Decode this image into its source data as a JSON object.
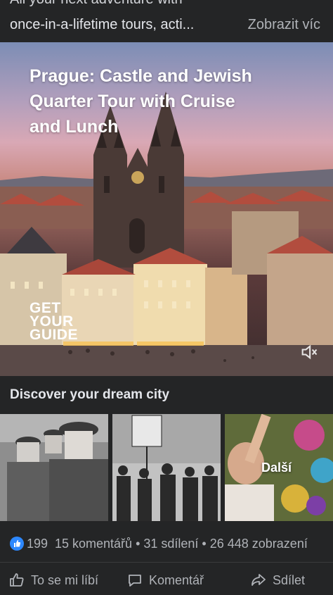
{
  "post": {
    "caption_partial": "All your next adventure with",
    "caption_line": "once-in-a-lifetime tours, acti...",
    "see_more": "Zobrazit víc"
  },
  "video": {
    "title": "Prague: Castle and Jewish Quarter Tour with Cruise and Lunch",
    "brand_logo": "GET YOUR GUIDE",
    "mute_icon": "speaker-muted-icon"
  },
  "discover": {
    "title": "Discover your dream city",
    "more_label": "Další",
    "thumbnails": [
      "historical-photo-officers",
      "historical-photo-protest",
      "colorful-photo-people"
    ]
  },
  "stats": {
    "like_count": "199",
    "details": "15 komentářů • 31 sdílení • 26 448 zobrazení"
  },
  "actions": {
    "like": "To se mi líbí",
    "comment": "Komentář",
    "share": "Sdílet"
  },
  "colors": {
    "background": "#18191a",
    "card": "#242526",
    "text": "#e4e6eb",
    "secondary": "#b0b3b8",
    "like_blue": "#2d88ff"
  }
}
